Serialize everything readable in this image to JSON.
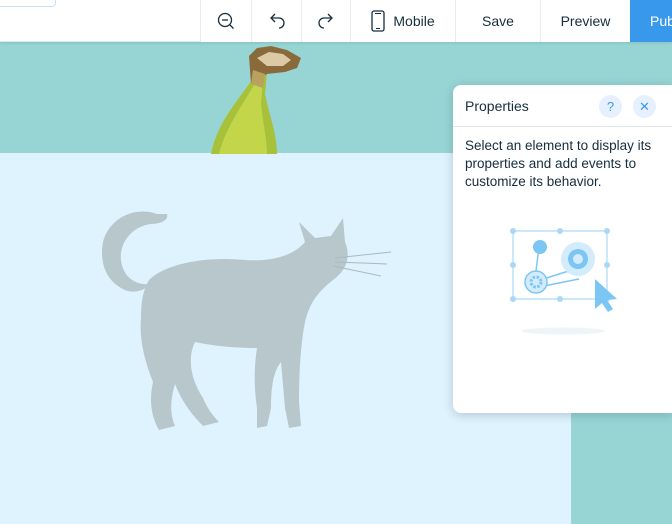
{
  "toolbar": {
    "zoom_out_icon": "zoom-out-icon",
    "undo_icon": "undo-icon",
    "redo_icon": "redo-icon",
    "mobile_label": "Mobile",
    "save_label": "Save",
    "preview_label": "Preview",
    "publish_label": "Pub",
    "colors": {
      "publish_bg": "#3899ec"
    }
  },
  "canvas": {
    "colors": {
      "teal": "#97d5d5",
      "light_blue": "#dff3fe"
    },
    "images": [
      "banana",
      "cat"
    ]
  },
  "properties_panel": {
    "title": "Properties",
    "help_label": "?",
    "close_label": "✕",
    "description": "Select an element to display its properties and add events to customize its behavior."
  }
}
